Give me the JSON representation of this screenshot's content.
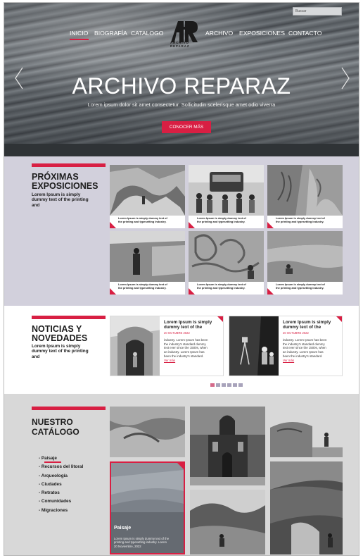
{
  "search": {
    "placeholder": "Buscar"
  },
  "nav": {
    "items": [
      "INICIO",
      "BIOGRAFÍA",
      "CATALOGO",
      "ARCHIVO",
      "EXPOSICIONES",
      "CONTACTO"
    ],
    "active": "INICIO"
  },
  "logo": {
    "letters": "AR",
    "line1": "ARCHIVO",
    "line2": "REPARAZ"
  },
  "hero": {
    "title": "ARCHIVO REPARAZ",
    "subtitle": "Lorem ipsum dolor sit amet consectetur. Sollicitudin scelerisque amet odio viverra",
    "button": "CONOCER MÁS"
  },
  "exposiciones": {
    "title_line1": "PRÓXIMAS",
    "title_line2": "EXPOSICIONES",
    "desc_line1": "Lorem Ipsum is simply",
    "desc_line2": "dummy text of the printing",
    "desc_line3": "and",
    "cards": [
      {
        "line1": "Lorem Ipsum is simply dummy text of",
        "line2": "the printing and typesetting industry."
      },
      {
        "line1": "Lorem Ipsum is simply dummy text of",
        "line2": "the printing and typesetting industry."
      },
      {
        "line1": "Lorem Ipsum is simply dummy text of",
        "line2": "the printing and typesetting industry."
      },
      {
        "line1": "Lorem Ipsum is simply dummy text of",
        "line2": "the printing and typesetting industry."
      },
      {
        "line1": "Lorem Ipsum is simply dummy text of",
        "line2": "the printing and typesetting industry."
      },
      {
        "line1": "Lorem Ipsum is simply dummy text of",
        "line2": "the printing and typesetting industry."
      }
    ]
  },
  "noticias": {
    "title_line1": "NOTICIAS Y",
    "title_line2": "NOVEDADES",
    "desc_line1": "Lorem Ipsum is simply",
    "desc_line2": "dummy text of the printing",
    "desc_line3": "and",
    "items": [
      {
        "title_line1": "Lorem Ipsum is simply",
        "title_line2": "dummy text of the",
        "date": "20 OCTUBRE 2022",
        "body": [
          "industry. Lorem Ipsum has been",
          "the industry's standard dummy",
          "text ever since the 1500s, when",
          "an industry. Lorem Ipsum has",
          "been the industry's standard."
        ],
        "more": "Ver más"
      },
      {
        "title_line1": "Lorem Ipsum is simply",
        "title_line2": "dummy text of the",
        "date": "20 OCTUBRE 2022",
        "body": [
          "industry. Lorem Ipsum has been",
          "the industry's standard dummy",
          "text ever since the 1500s, when",
          "an industry. Lorem Ipsum has",
          "been the industry's standard."
        ],
        "more": "Ver más"
      }
    ],
    "pagination_count": 6,
    "pagination_active": 1
  },
  "catalogo": {
    "title_line1": "NUESTRO",
    "title_line2": "CATÁLOGO",
    "categories": [
      "Paisaje",
      "Recursos del litoral",
      "Arqueología",
      "Ciudades",
      "Retratos",
      "Comunidades",
      "Migraciones"
    ],
    "selected": "Paisaje",
    "featured": {
      "title": "Paisaje",
      "body": [
        "Lorem Ipsum is simply dummy text of the",
        "printing and typesetting industry. Lorem",
        "20 Noviembre, 2022"
      ]
    }
  },
  "colors": {
    "accent": "#d81f43",
    "section1_bg": "#d2d0dc",
    "section3_bg": "#d8d8d8"
  }
}
